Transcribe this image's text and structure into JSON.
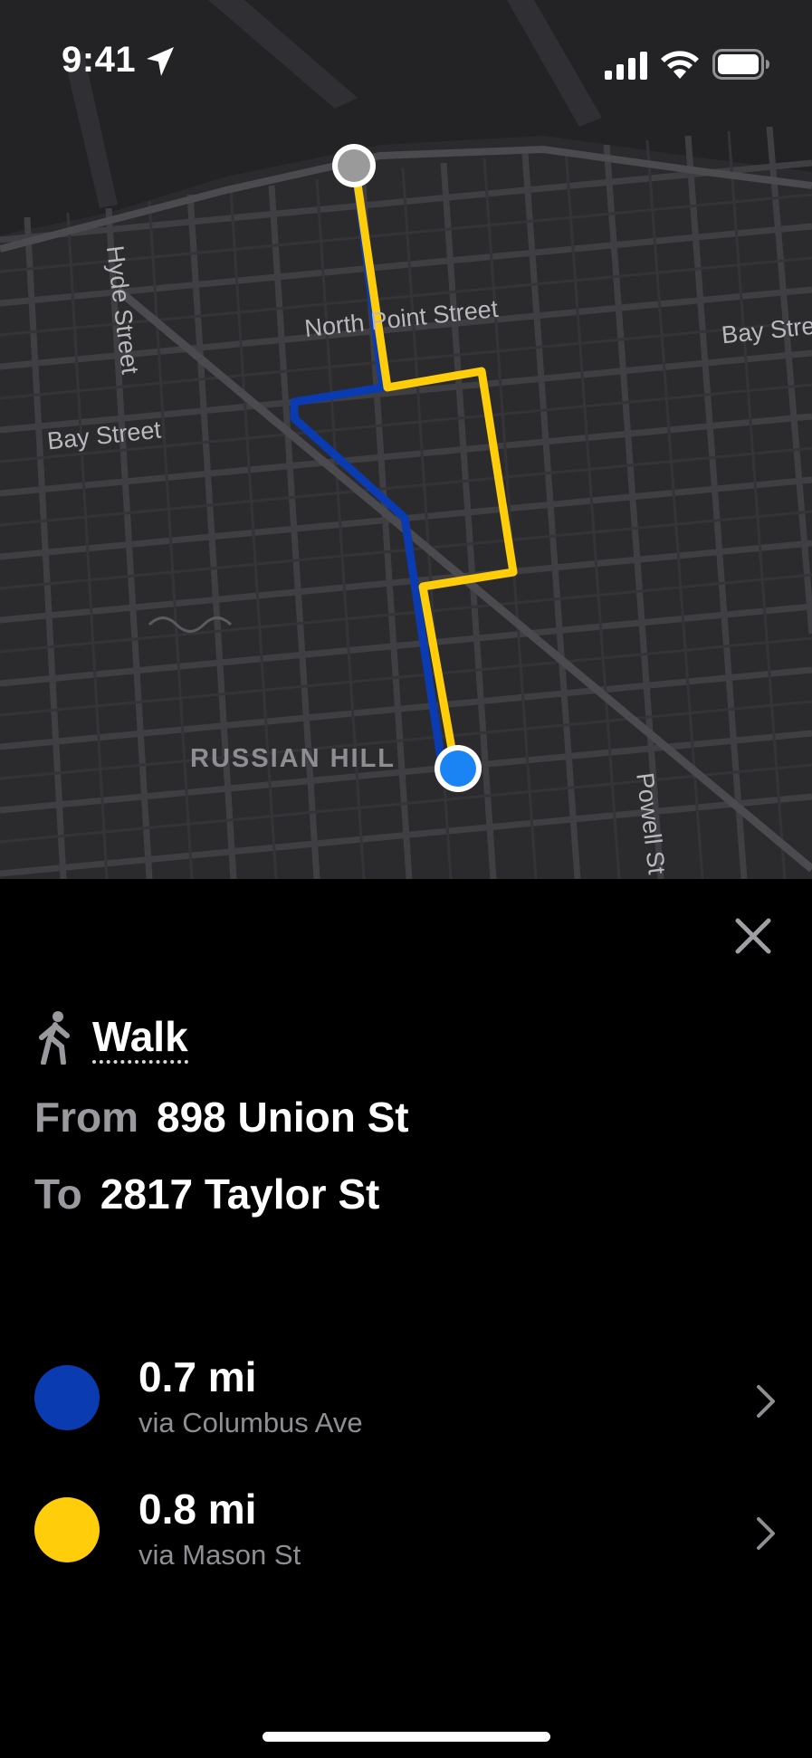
{
  "status_bar": {
    "time": "9:41",
    "icons": [
      "location-arrow-icon",
      "cellular-signal-icon",
      "wifi-icon",
      "battery-icon"
    ]
  },
  "map": {
    "street_labels": {
      "north_point": "North Point Street",
      "bay_right": "Bay Stre",
      "hyde": "Hyde Street",
      "bay_left": "Bay Street",
      "powell": "Powell St"
    },
    "district_label": "RUSSIAN HILL",
    "colors": {
      "background": "#2b2b2e",
      "water": "#232326",
      "streets": "#3d3d41",
      "origin_marker": "#9a9a9a",
      "destination_marker": "#1a84f5"
    }
  },
  "directions": {
    "close_icon": "close-icon",
    "mode_icon": "walking-person-icon",
    "mode_label": "Walk",
    "from_label": "From",
    "from_value": "898 Union St",
    "to_label": "To",
    "to_value": "2817 Taylor St"
  },
  "routes": [
    {
      "distance": "0.7 mi",
      "via": "via Columbus Ave",
      "color": "#0b3bb0"
    },
    {
      "distance": "0.8 mi",
      "via": "via Mason St",
      "color": "#ffcd0a"
    }
  ]
}
